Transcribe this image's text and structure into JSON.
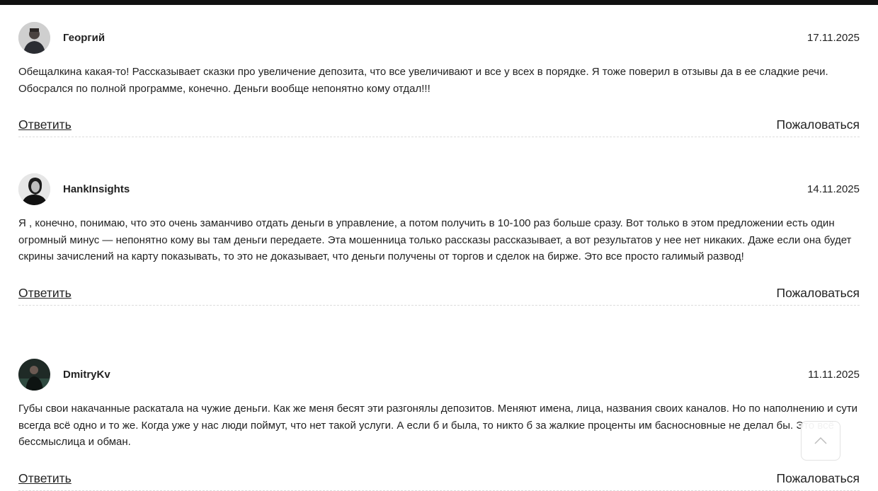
{
  "comments": [
    {
      "author": "Георгий",
      "date": "17.11.2025",
      "text": "Обещалкина какая-то! Рассказывает сказки про увеличение депозита, что все увеличивают и все у всех в порядке. Я тоже поверил в отзывы да в ее сладкие речи. Обосрался по полной программе, конечно. Деньги вообще непонятно кому отдал!!!",
      "reply_label": "Ответить",
      "complain_label": "Пожаловаться"
    },
    {
      "author": "HankInsights",
      "date": "14.11.2025",
      "text": "Я , конечно, понимаю, что это очень заманчиво отдать деньги в управление, а потом получить в 10-100 раз больше сразу. Вот только в этом предложении есть один огромный минус — непонятно кому вы там деньги передаете. Эта мошенница только рассказы рассказывает, а вот результатов у нее нет никаких. Даже если она будет скрины зачислений на карту показывать, то это не доказывает, что деньги получены от торгов и сделок на бирже. Это все просто галимый развод!",
      "reply_label": "Ответить",
      "complain_label": "Пожаловаться"
    },
    {
      "author": "DmitryKv",
      "date": "11.11.2025",
      "text": "Губы свои накачанные раскатала на чужие деньги. Как же меня бесят эти разгонялы депозитов. Меняют имена, лица, названия своих каналов. Но по наполнению и сути всегда всё одно и то же. Когда уже у нас люди поймут, что нет такой услуги. А если б и была, то никто б за жалкие проценты им басносновные не делал бы. Это всё бессмыслица и обман.",
      "reply_label": "Ответить",
      "complain_label": "Пожаловаться"
    }
  ],
  "scroll_top_icon": "chevron-up-icon"
}
